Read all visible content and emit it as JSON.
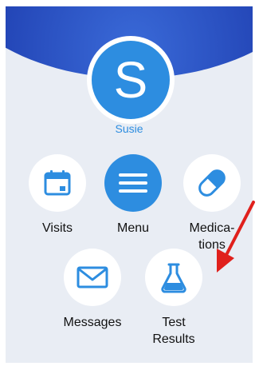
{
  "user": {
    "initial": "S",
    "name": "Susie"
  },
  "tiles": [
    {
      "line1": "Visits",
      "line2": "",
      "icon": "calendar-icon"
    },
    {
      "line1": "Menu",
      "line2": "",
      "icon": "hamburger-menu-icon"
    },
    {
      "line1": "Medica-",
      "line2": "tions",
      "icon": "pill-capsule-icon"
    },
    {
      "line1": "Messages",
      "line2": "",
      "icon": "envelope-icon"
    },
    {
      "line1": "Test",
      "line2": "Results",
      "icon": "flask-icon"
    }
  ],
  "colors": {
    "accent": "#2d8de0",
    "header_dark": "#1a2f8a",
    "panel_background": "#e9edf4",
    "annotation_arrow": "#e0201c"
  }
}
